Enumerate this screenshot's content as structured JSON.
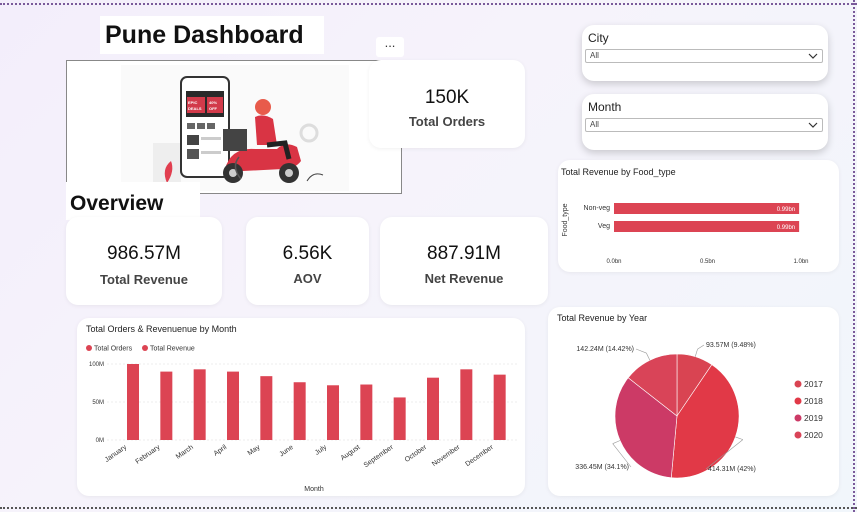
{
  "page": {
    "title": "Pune Dashboard",
    "overview_heading": "Overview",
    "more_options": "..."
  },
  "kpis": {
    "total_orders": {
      "value": "150K",
      "label": "Total Orders"
    },
    "total_revenue": {
      "value": "986.57M",
      "label": "Total Revenue"
    },
    "aov": {
      "value": "6.56K",
      "label": "AOV"
    },
    "net_revenue": {
      "value": "887.91M",
      "label": "Net Revenue"
    }
  },
  "slicers": {
    "city": {
      "label": "City",
      "value": "All"
    },
    "month": {
      "label": "Month",
      "value": "All"
    }
  },
  "banner": {
    "promo_1": "EPIC DEALS",
    "promo_2": "40% OFF"
  },
  "colors": {
    "accent": "#dc4453",
    "pie_2017": "#d94452",
    "pie_2018": "#e13947",
    "pie_2019": "#cc3a66",
    "pie_2020": "#d94458"
  },
  "chart_data": [
    {
      "type": "bar",
      "title": "Total Revenue by Food_type",
      "orientation": "horizontal",
      "categories": [
        "Non-veg",
        "Veg"
      ],
      "values": [
        0.99,
        0.99
      ],
      "data_labels": [
        "0.99bn",
        "0.99bn"
      ],
      "ylabel": "Food_type",
      "ticks": [
        "0.0bn",
        "0.5bn",
        "1.0bn"
      ],
      "xlim": [
        0,
        1.0
      ]
    },
    {
      "type": "bar",
      "title": "Total Orders & Revenuenue by Month",
      "legend": [
        "Total Orders",
        "Total Revenue"
      ],
      "categories": [
        "January",
        "February",
        "March",
        "April",
        "May",
        "June",
        "July",
        "August",
        "September",
        "October",
        "November",
        "December"
      ],
      "series": [
        {
          "name": "Total Orders",
          "values": [
            0.013,
            0.012,
            0.013,
            0.012,
            0.013,
            0.012,
            0.012,
            0.012,
            0.011,
            0.012,
            0.013,
            0.012
          ]
        },
        {
          "name": "Total Revenue",
          "values": [
            100,
            90,
            93,
            90,
            84,
            76,
            72,
            73,
            56,
            82,
            93,
            86
          ]
        }
      ],
      "xlabel": "Month",
      "yticks": [
        "0M",
        "50M",
        "100M"
      ],
      "ylim": [
        0,
        100
      ]
    },
    {
      "type": "pie",
      "title": "Total Revenue by Year",
      "categories": [
        "2017",
        "2018",
        "2019",
        "2020"
      ],
      "values": [
        93.57,
        414.31,
        336.45,
        142.24
      ],
      "data_labels": [
        "93.57M (9.48%)",
        "414.31M (42%)",
        "336.45M (34.1%)",
        "142.24M (14.42%)"
      ],
      "legend": [
        "2017",
        "2018",
        "2019",
        "2020"
      ]
    }
  ]
}
